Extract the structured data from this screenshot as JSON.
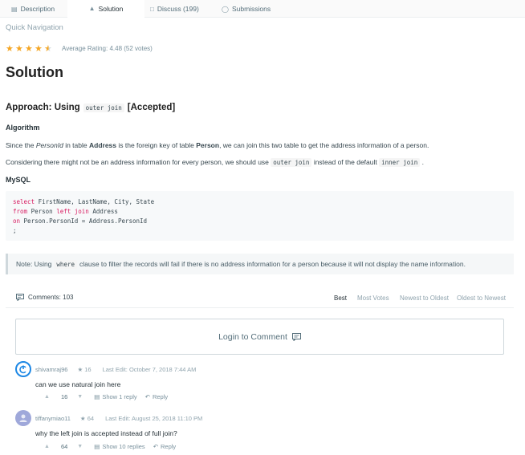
{
  "tabs": [
    {
      "label": "Description",
      "icon": "description-icon"
    },
    {
      "label": "Solution",
      "icon": "flask-icon"
    },
    {
      "label": "Discuss (199)",
      "icon": "discuss-icon"
    },
    {
      "label": "Submissions",
      "icon": "clock-icon"
    }
  ],
  "quick_nav": "Quick Navigation",
  "rating": {
    "stars": 4.5,
    "average_text": "Average Rating: 4.48 (52 votes)",
    "star_color": "#f5a623"
  },
  "solution_title": "Solution",
  "approach": {
    "prefix": "Approach: Using",
    "code": "outer join",
    "suffix": "[Accepted]"
  },
  "algorithm_heading": "Algorithm",
  "para1": {
    "t1": "Since the ",
    "personid": "PersonId",
    "t2": " in table ",
    "address": "Address",
    "t3": " is the foreign key of table ",
    "person": "Person",
    "t4": ", we can join this two table to get the address information of a person."
  },
  "para2": {
    "t1": "Considering there might not be an address information for every person, we should use",
    "code1": "outer join",
    "t2": "instead of the default",
    "code2": "inner join",
    "t3": "."
  },
  "mysql_heading": "MySQL",
  "code": {
    "l1_kw": "select",
    "l1_rest": " FirstName, LastName, City, State",
    "l2_kw": "from",
    "l2_mid": " Person ",
    "l2_kw2": "left join",
    "l2_rest": " Address",
    "l3_kw": "on",
    "l3_rest": " Person.PersonId = Address.PersonId",
    "l4": ";"
  },
  "note": {
    "t1": "Note: Using",
    "code": "where",
    "t2": "clause to filter the records will fail if there is no address information for a person because it will not display the name information."
  },
  "comments": {
    "count_label": "Comments: 103",
    "sort_options": [
      "Best",
      "Most Votes",
      "Newest to Oldest",
      "Oldest to Newest"
    ],
    "login_label": "Login to Comment",
    "items": [
      {
        "user": "shivamraj96",
        "rep": "16",
        "edited": "Last Edit: October 7, 2018 7:44 AM",
        "text": "can we use natural join here",
        "votes": "16",
        "replies": "Show 1 reply",
        "reply": "Reply",
        "avatar_color": "#1e88e5"
      },
      {
        "user": "tiffanymiao11",
        "rep": "64",
        "edited": "Last Edit: August 25, 2018 11:10 PM",
        "text": "why the left join is accepted instead of full join?",
        "votes": "64",
        "replies": "Show 10 replies",
        "reply": "Reply",
        "avatar_color": "#9fa8da"
      }
    ]
  }
}
